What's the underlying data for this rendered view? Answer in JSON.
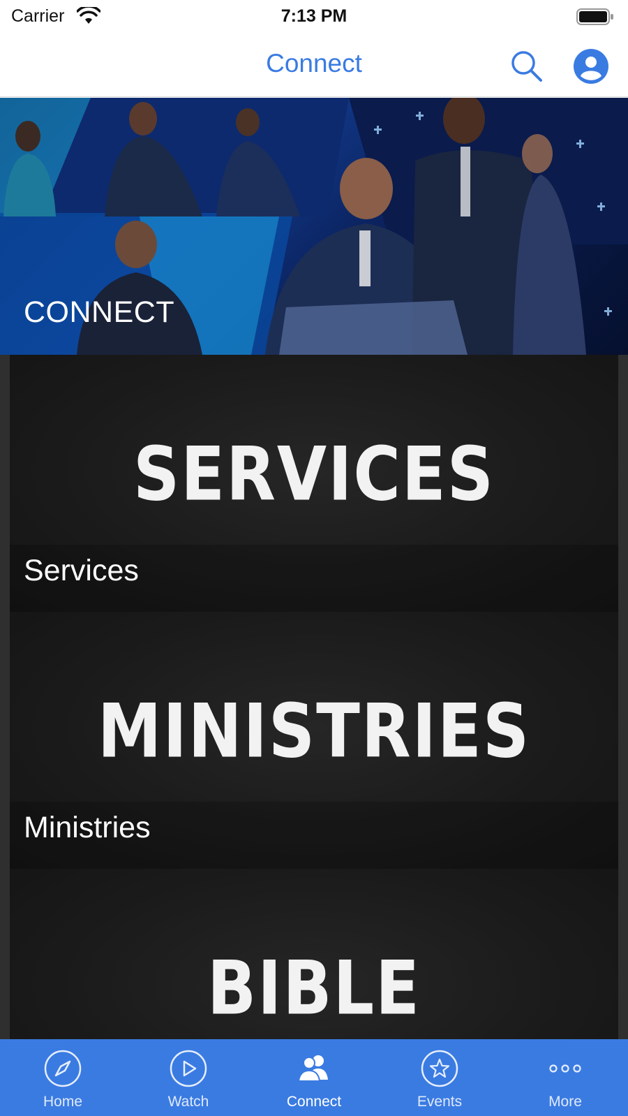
{
  "status_bar": {
    "carrier": "Carrier",
    "time": "7:13 PM"
  },
  "nav": {
    "title": "Connect",
    "search_icon": "search-icon",
    "profile_icon": "profile-icon"
  },
  "hero": {
    "label": "CONNECT"
  },
  "tiles": [
    {
      "title": "SERVICES",
      "label": "Services"
    },
    {
      "title": "MINISTRIES",
      "label": "Ministries"
    },
    {
      "title": "BIBLE",
      "label": ""
    }
  ],
  "tab_bar": {
    "active": "Connect",
    "tabs": [
      {
        "label": "Home",
        "icon": "compass-icon"
      },
      {
        "label": "Watch",
        "icon": "play-icon"
      },
      {
        "label": "Connect",
        "icon": "people-icon"
      },
      {
        "label": "Events",
        "icon": "star-icon"
      },
      {
        "label": "More",
        "icon": "more-icon"
      }
    ]
  },
  "colors": {
    "accent": "#3a7be2",
    "tile_background": "#1b1b1b",
    "tab_bar": "#3a7be2"
  }
}
